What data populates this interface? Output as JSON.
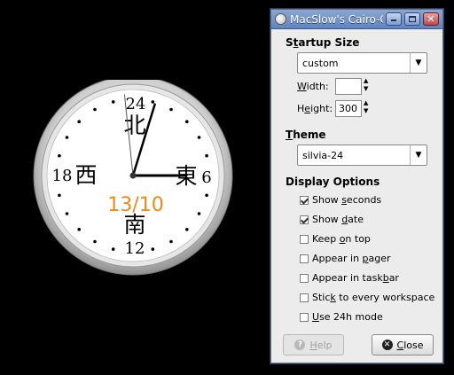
{
  "clock": {
    "numbers": {
      "top": "24",
      "right": "6",
      "bottom": "12",
      "left": "18"
    },
    "directions": {
      "north": "北",
      "east": "東",
      "south": "南",
      "west": "西"
    },
    "date": "13/10",
    "date_color": "#f08a16",
    "time": {
      "hour_hand_deg": 90,
      "minute_hand_deg": 17,
      "second_hand_deg": 354
    }
  },
  "dialog": {
    "title": "MacSlow's Cairo-Cl",
    "startup_size": {
      "heading": {
        "pre": "S",
        "mn": "t",
        "post": "artup Size"
      },
      "combo_value": "custom",
      "width_label": {
        "pre": "",
        "mn": "W",
        "post": "idth:"
      },
      "width_value": "",
      "height_label": {
        "pre": "H",
        "mn": "e",
        "post": "ight:"
      },
      "height_value": "300"
    },
    "theme": {
      "heading": {
        "pre": "",
        "mn": "T",
        "post": "heme"
      },
      "combo_value": "silvia-24"
    },
    "display_options": {
      "heading": "Display Options",
      "items": [
        {
          "pre": "Show ",
          "mn": "s",
          "post": "econds",
          "checked": true
        },
        {
          "pre": "Show ",
          "mn": "d",
          "post": "ate",
          "checked": true
        },
        {
          "pre": "Keep ",
          "mn": "o",
          "post": "n top",
          "checked": false
        },
        {
          "pre": "Appear in ",
          "mn": "p",
          "post": "ager",
          "checked": false
        },
        {
          "pre": "Appear in task",
          "mn": "b",
          "post": "ar",
          "checked": false
        },
        {
          "pre": "Stic",
          "mn": "k",
          "post": " to every workspace",
          "checked": false
        },
        {
          "pre": "",
          "mn": "U",
          "post": "se 24h mode",
          "checked": false
        }
      ]
    },
    "buttons": {
      "help": {
        "pre": "",
        "mn": "H",
        "post": "elp"
      },
      "close": {
        "pre": "",
        "mn": "C",
        "post": "lose"
      }
    }
  }
}
